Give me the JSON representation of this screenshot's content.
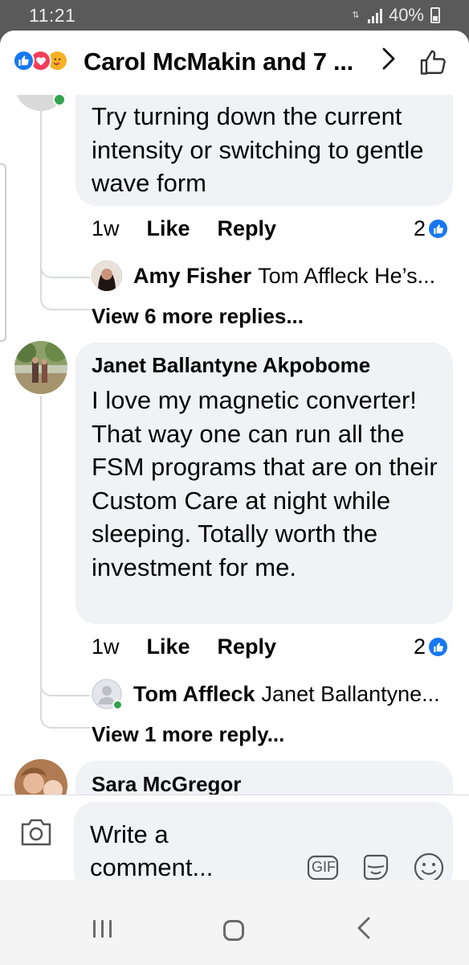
{
  "status_bar": {
    "time": "11:21",
    "battery": "40%"
  },
  "header": {
    "title": "Carol McMakin and 7 ..."
  },
  "comments": [
    {
      "text": "Try turning down the current intensity or switching to gentle wave form",
      "time": "1w",
      "like_label": "Like",
      "reply_label": "Reply",
      "reaction_count": "2",
      "reply_preview": {
        "name": "Amy Fisher",
        "text": "Tom Affleck He’s..."
      },
      "view_more": "View 6 more replies..."
    },
    {
      "author": "Janet Ballantyne Akpobome",
      "text": "I love my magnetic converter! That way one can run all the FSM programs that are on their Custom Care at night while sleeping. Totally worth the investment for me.",
      "time": "1w",
      "like_label": "Like",
      "reply_label": "Reply",
      "reaction_count": "2",
      "reply_preview": {
        "name": "Tom Affleck",
        "text": "Janet Ballantyne..."
      },
      "view_more": "View 1 more reply..."
    },
    {
      "author": "Sara McGregor"
    }
  ],
  "composer": {
    "placeholder": "Write a comment...",
    "gif_label": "GIF"
  },
  "colors": {
    "accent": "#1877f2",
    "bubble": "#f0f2f5",
    "online": "#31a24c",
    "love": "#f33e58",
    "care": "#f7b125"
  }
}
